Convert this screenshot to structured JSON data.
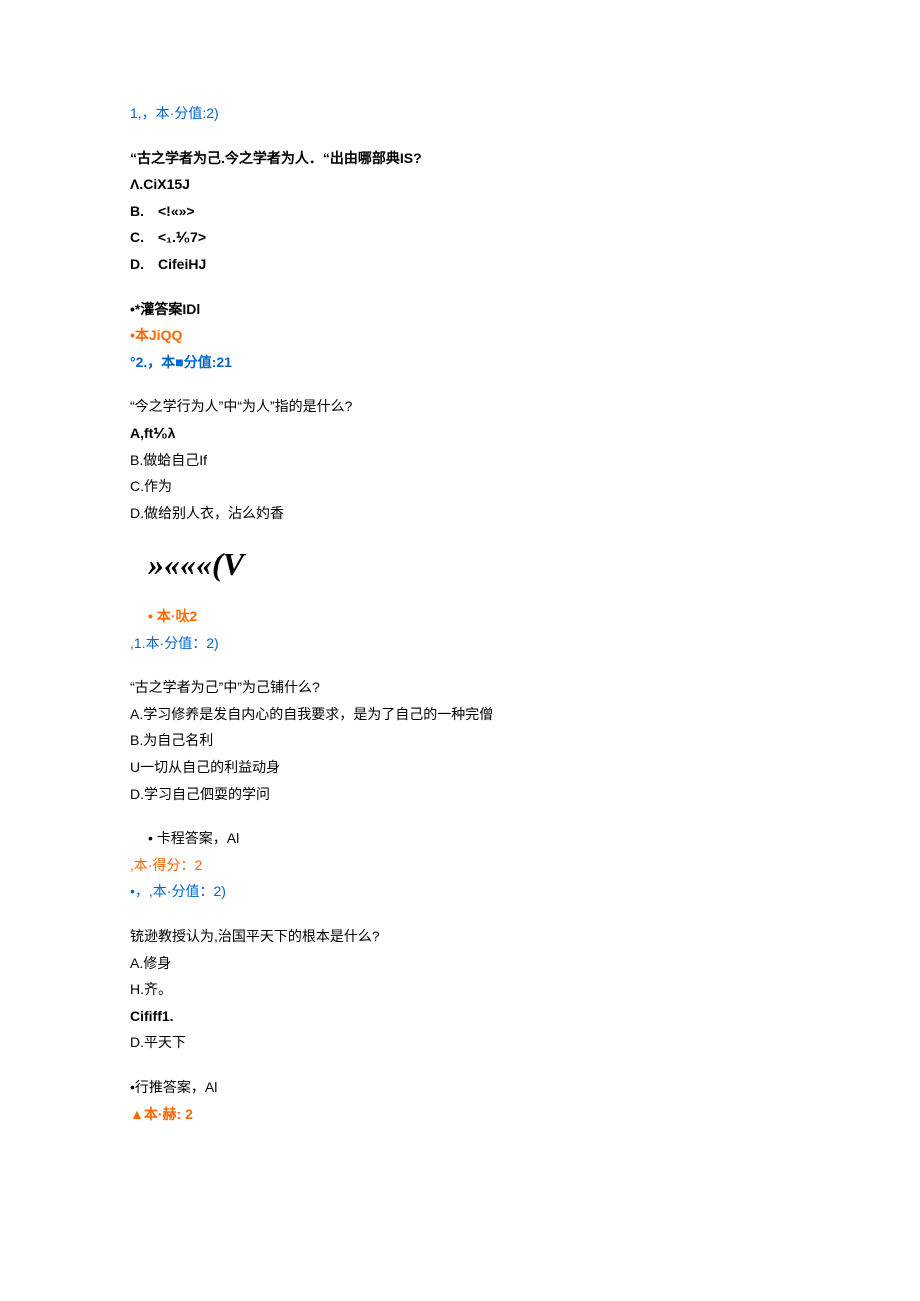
{
  "q1": {
    "header": "1,，本·分值:2)",
    "stem": "“古之学者为己.今之学者为人．“出由哪部典IS?",
    "optA": "Λ.CiX15J",
    "optB": "B.　<!«»>",
    "optC": "C.　<₁.⅟₀7>",
    "optD": "D.　CifeiHJ",
    "ans": "•*灌答案IDl",
    "score": "•本JiQQ"
  },
  "q2": {
    "header": "°2.，本■分值:21",
    "stem": "“今之学行为人”中“为人”指的是什么?",
    "optA": "A,ft⅟₀λ",
    "optB": "B.做蛤自己If",
    "optC": "C.作为",
    "optD": "D.做给别人衣，沾么妁香",
    "symbol": "»«««(V",
    "score": "本·呔2"
  },
  "q3": {
    "header": ",1.本·分值：2)",
    "stem": "“古之学者为己”中”为己铺什么?",
    "optA": "A.学习修养是发自内心的自我要求，是为了自己的一种完僧",
    "optB": "B.为自己名利",
    "optC": "U一切从自己的利益动身",
    "optD": "D.学习自己伵耍的学问",
    "ans": "卡程答案，Al",
    "score": ",本·得分：2"
  },
  "q4": {
    "header": "•，,本·分值：2)",
    "stem": "铳逊教授认为,治国平天下的根本是什么?",
    "optA": "A.修身",
    "optB": "H.齐。",
    "optC": "Cififf1.",
    "optD": "D.平天下",
    "ans": "•行推答案，Al",
    "score": "▲本·赫:  2"
  }
}
